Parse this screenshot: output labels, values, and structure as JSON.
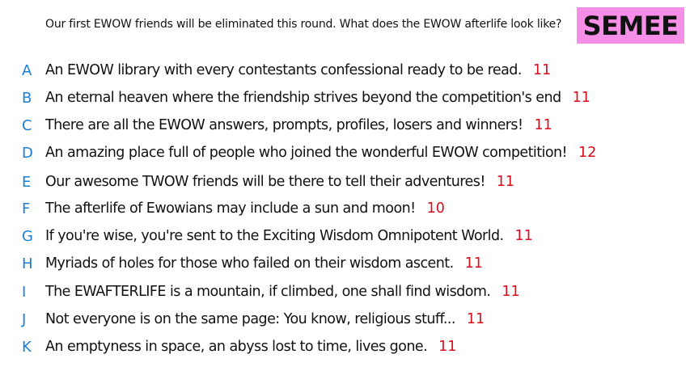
{
  "prompt": "Our first EWOW friends will be eliminated this round. What does the EWOW afterlife look like?",
  "badge": {
    "label": "SEMEE",
    "color": "#f58ee6"
  },
  "colors": {
    "letter": "#1b7fd9",
    "count": "#d90e1c",
    "text": "#111111"
  },
  "responses": [
    {
      "letter": "A",
      "text": "An EWOW library with every contestants confessional ready to be read.",
      "count": "11"
    },
    {
      "letter": "B",
      "text": "An eternal heaven where the friendship strives beyond the competition's end",
      "count": "11"
    },
    {
      "letter": "C",
      "text": "There are all the EWOW answers, prompts, profiles, losers and winners!",
      "count": "11"
    },
    {
      "letter": "D",
      "text": "An amazing place full of people who joined the wonderful EWOW competition!",
      "count": "12"
    },
    {
      "letter": "E",
      "text": "Our awesome TWOW friends will be there to tell their adventures!",
      "count": "11"
    },
    {
      "letter": "F",
      "text": "The afterlife of Ewowians may include a sun and moon!",
      "count": "10"
    },
    {
      "letter": "G",
      "text": "If you're wise, you're sent to the Exciting Wisdom Omnipotent World.",
      "count": "11"
    },
    {
      "letter": "H",
      "text": "Myriads of holes for those who failed on their wisdom ascent.",
      "count": "11"
    },
    {
      "letter": "I",
      "text": "The EWAFTERLIFE is a mountain, if climbed, one shall find wisdom.",
      "count": "11"
    },
    {
      "letter": "J",
      "text": "Not everyone is on the same page: You know, religious stuff...",
      "count": "11"
    },
    {
      "letter": "K",
      "text": "An emptyness in space, an abyss lost to time, lives gone.",
      "count": "11"
    }
  ]
}
